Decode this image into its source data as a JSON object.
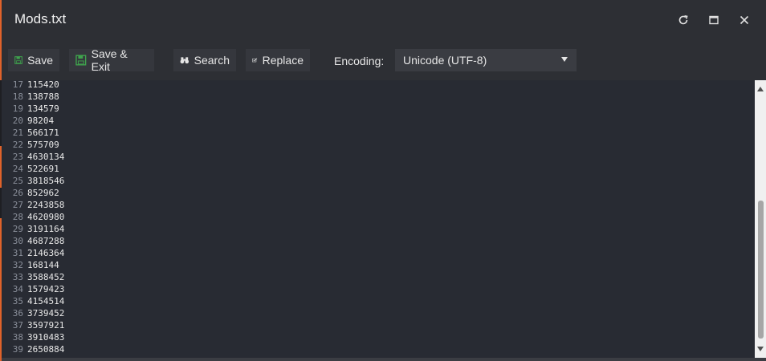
{
  "window": {
    "title": "Mods.txt",
    "controls": [
      "refresh-icon",
      "maximize-icon",
      "close-icon"
    ]
  },
  "toolbar": {
    "save_label": "Save",
    "save_exit_label": "Save & Exit",
    "search_label": "Search",
    "replace_label": "Replace",
    "encoding_label": "Encoding:",
    "encoding_value": "Unicode (UTF-8)"
  },
  "editor": {
    "lines": [
      {
        "num": "17",
        "text": "115420"
      },
      {
        "num": "18",
        "text": "138788"
      },
      {
        "num": "19",
        "text": "134579"
      },
      {
        "num": "20",
        "text": "98204"
      },
      {
        "num": "21",
        "text": "566171"
      },
      {
        "num": "22",
        "text": "575709"
      },
      {
        "num": "23",
        "text": "4630134"
      },
      {
        "num": "24",
        "text": "522691"
      },
      {
        "num": "25",
        "text": "3818546"
      },
      {
        "num": "26",
        "text": "852962"
      },
      {
        "num": "27",
        "text": "2243858"
      },
      {
        "num": "28",
        "text": "4620980"
      },
      {
        "num": "29",
        "text": "3191164"
      },
      {
        "num": "30",
        "text": "4687288"
      },
      {
        "num": "31",
        "text": "2146364"
      },
      {
        "num": "32",
        "text": "168144"
      },
      {
        "num": "33",
        "text": "3588452"
      },
      {
        "num": "34",
        "text": "1579423"
      },
      {
        "num": "35",
        "text": "4154514"
      },
      {
        "num": "36",
        "text": "3739452"
      },
      {
        "num": "37",
        "text": "3597921"
      },
      {
        "num": "38",
        "text": "3910483"
      },
      {
        "num": "39",
        "text": "2650884"
      }
    ]
  },
  "colors": {
    "accent": "#e0622a",
    "save_icon": "#3fa34d",
    "background": "#2b2d33",
    "editor_background": "#282b33"
  }
}
